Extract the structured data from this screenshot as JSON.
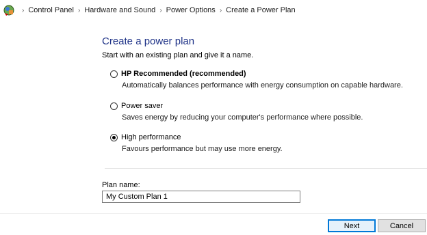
{
  "breadcrumb": {
    "icon": "control-panel-icon",
    "items": [
      "Control Panel",
      "Hardware and Sound",
      "Power Options",
      "Create a Power Plan"
    ],
    "separator": "›"
  },
  "page": {
    "title": "Create a power plan",
    "subtitle": "Start with an existing plan and give it a name."
  },
  "options": [
    {
      "label": "HP Recommended (recommended)",
      "description": "Automatically balances performance with energy consumption on capable hardware.",
      "checked": false
    },
    {
      "label": "Power saver",
      "description": "Saves energy by reducing your computer's performance where possible.",
      "checked": false
    },
    {
      "label": "High performance",
      "description": "Favours performance but may use more energy.",
      "checked": true
    }
  ],
  "plan_name": {
    "label": "Plan name:",
    "value": "My Custom Plan 1"
  },
  "buttons": {
    "next": "Next",
    "cancel": "Cancel"
  },
  "colors": {
    "title": "#1e3287",
    "primary_border": "#0078d7"
  }
}
